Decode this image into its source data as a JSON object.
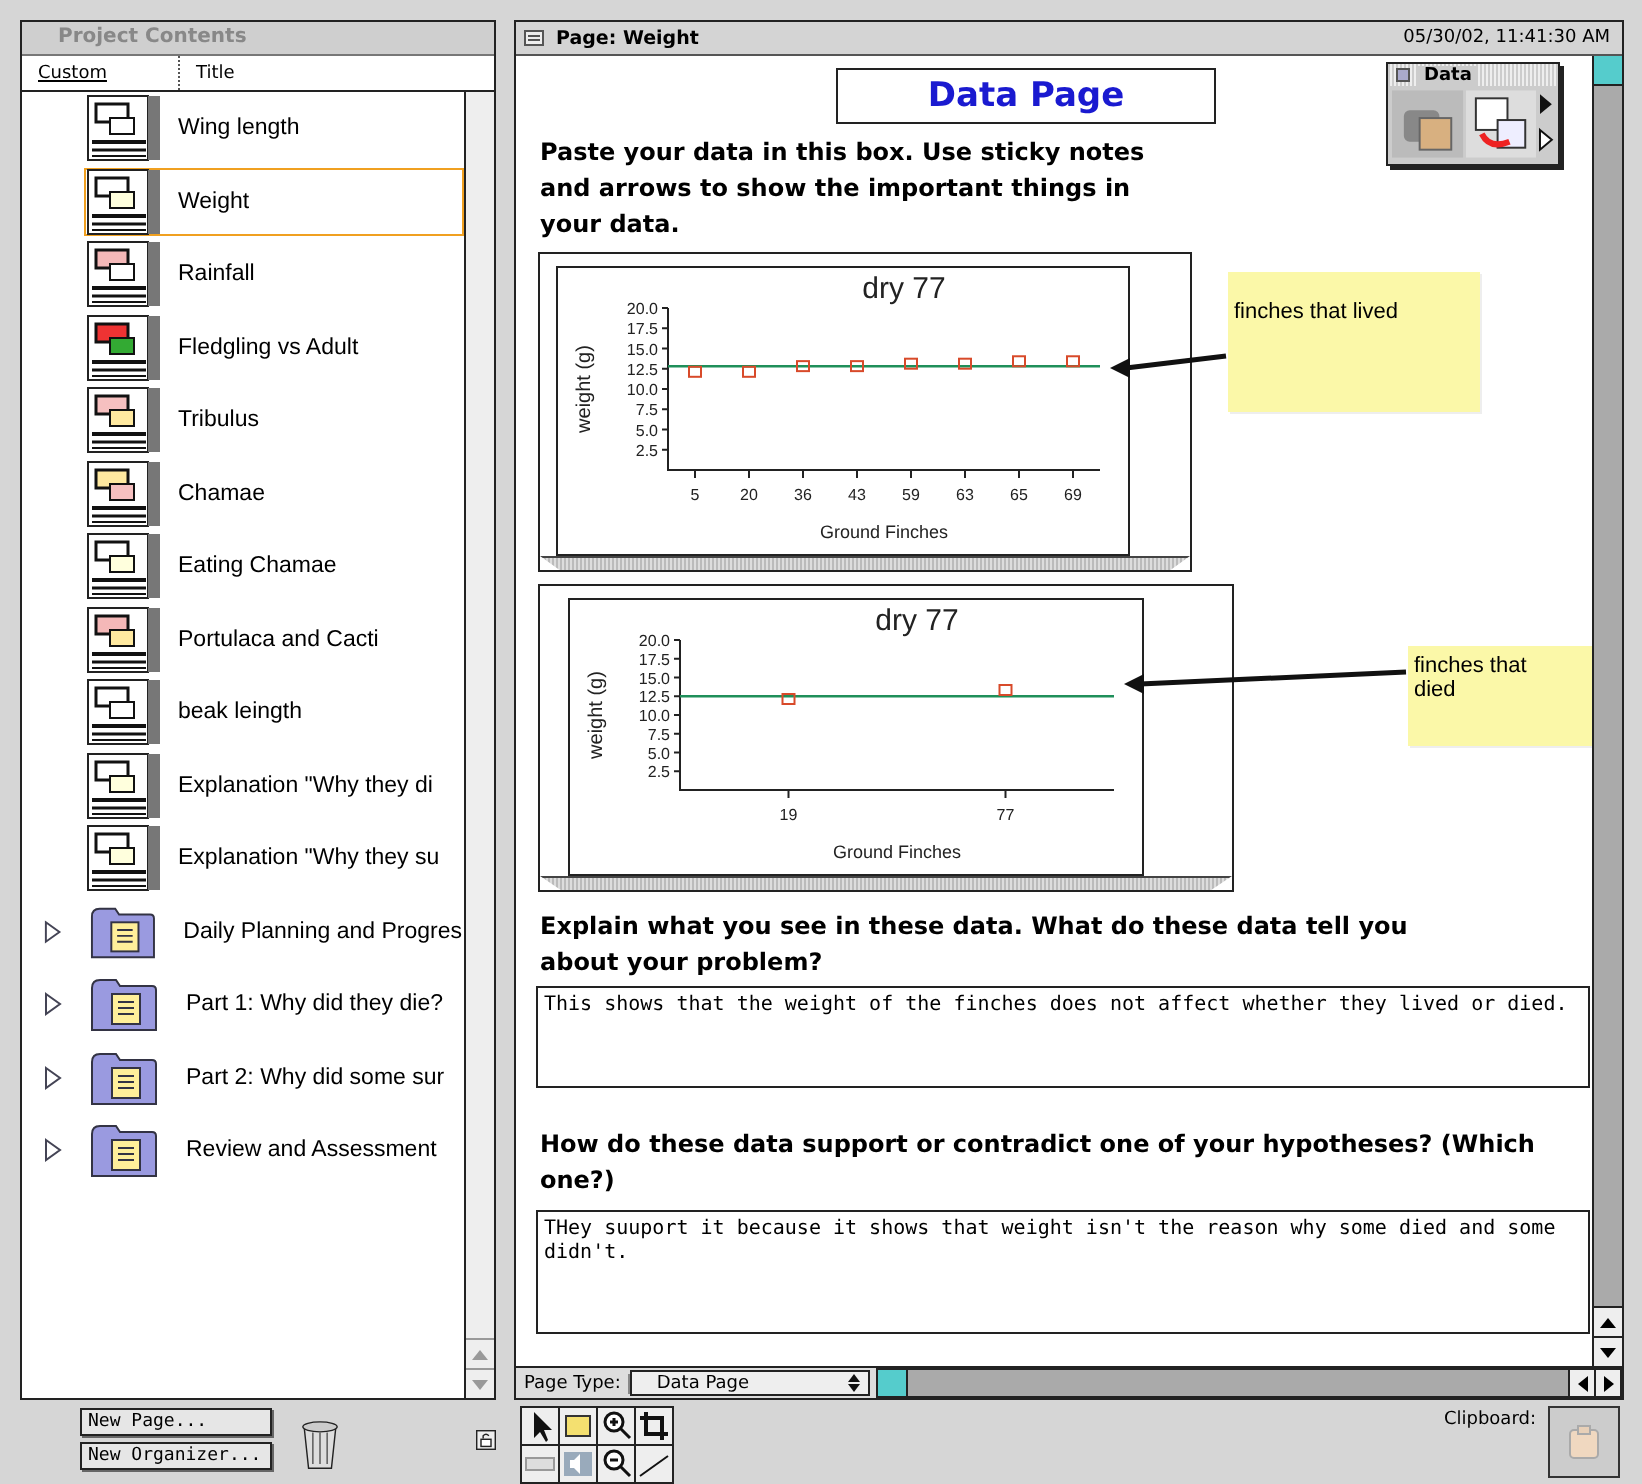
{
  "project_panel": {
    "title": "Project Contents",
    "columns": [
      {
        "label": "Custom",
        "selected": true
      },
      {
        "label": "Title",
        "selected": false
      }
    ],
    "items": [
      {
        "kind": "page",
        "label": "Wing length",
        "selected": false
      },
      {
        "kind": "page",
        "label": "Weight",
        "selected": true
      },
      {
        "kind": "page",
        "label": "Rainfall",
        "selected": false
      },
      {
        "kind": "page",
        "label": "Fledgling vs Adult",
        "selected": false
      },
      {
        "kind": "page",
        "label": "Tribulus",
        "selected": false
      },
      {
        "kind": "page",
        "label": "Chamae",
        "selected": false
      },
      {
        "kind": "page",
        "label": "Eating Chamae",
        "selected": false
      },
      {
        "kind": "page",
        "label": "Portulaca and Cacti",
        "selected": false
      },
      {
        "kind": "page",
        "label": "beak leingth",
        "selected": false
      },
      {
        "kind": "page",
        "label": "Explanation \"Why they di",
        "selected": false
      },
      {
        "kind": "page",
        "label": "Explanation \"Why they su",
        "selected": false
      },
      {
        "kind": "folder",
        "label": "Daily Planning and Progres",
        "expanded": false,
        "selected": false
      },
      {
        "kind": "folder",
        "label": "Part 1: Why did they die?",
        "expanded": false,
        "selected": false
      },
      {
        "kind": "folder",
        "label": "Part 2: Why did some sur",
        "expanded": false,
        "selected": false
      },
      {
        "kind": "folder",
        "label": "Review and Assessment",
        "expanded": false,
        "selected": false
      }
    ],
    "buttons": [
      "New Page...",
      "New Organizer..."
    ]
  },
  "page_window": {
    "title": "Page: Weight",
    "timestamp": "05/30/02, 11:41:30 AM",
    "heading": "Data Page",
    "palette": {
      "title": "Data"
    },
    "instructions": "Paste your data in this box. Use sticky notes and arrows to show the important things in your data.",
    "charts": [
      {
        "note": "finches that lived",
        "chart_data": {
          "type": "scatter",
          "title": "dry 77",
          "xlabel": "Ground Finches",
          "ylabel": "weight (g)",
          "categories": [
            "5",
            "20",
            "36",
            "43",
            "59",
            "63",
            "65",
            "69"
          ],
          "series": [
            {
              "color": "#d84a2a",
              "values": [
                12.0,
                12.0,
                12.7,
                12.7,
                13.0,
                13.0,
                13.3,
                13.3
              ]
            }
          ],
          "ylim": [
            0,
            20
          ],
          "yticks": [
            {
              "value": 2.5,
              "label": "2.5"
            },
            {
              "value": 5,
              "label": "5.0"
            },
            {
              "value": 7.5,
              "label": "7.5"
            },
            {
              "value": 10,
              "label": "10.0"
            },
            {
              "value": 12.5,
              "label": "12.5"
            },
            {
              "value": 15,
              "label": "15.0"
            },
            {
              "value": 17.5,
              "label": "17.5"
            },
            {
              "value": 20,
              "label": "20.0"
            }
          ],
          "ref_lines": [
            {
              "axis": "y",
              "value": 12.8,
              "color": "#1f8f5a"
            }
          ]
        }
      },
      {
        "note": "finches that died",
        "chart_data": {
          "type": "scatter",
          "title": "dry 77",
          "xlabel": "Ground Finches",
          "ylabel": "weight (g)",
          "categories": [
            "19",
            "77"
          ],
          "series": [
            {
              "color": "#d84a2a",
              "values": [
                12.0,
                13.2
              ]
            }
          ],
          "ylim": [
            0,
            20
          ],
          "yticks": [
            {
              "value": 2.5,
              "label": "2.5"
            },
            {
              "value": 5,
              "label": "5.0"
            },
            {
              "value": 7.5,
              "label": "7.5"
            },
            {
              "value": 10,
              "label": "10.0"
            },
            {
              "value": 12.5,
              "label": "12.5"
            },
            {
              "value": 15,
              "label": "15.0"
            },
            {
              "value": 17.5,
              "label": "17.5"
            },
            {
              "value": 20,
              "label": "20.0"
            }
          ],
          "ref_lines": [
            {
              "axis": "y",
              "value": 12.5,
              "color": "#1f8f5a"
            }
          ]
        }
      }
    ],
    "questions": [
      {
        "prompt": "Explain what you see in these data.  What do these data tell you about your problem?",
        "answer": "This shows that the weight of the finches does not affect whether they lived or died."
      },
      {
        "prompt": "How do these data support or contradict one of your hypotheses? (Which one?)",
        "answer": "THey suuport it because it shows that weight isn't the reason why some died and some didn't."
      }
    ],
    "page_type": {
      "label": "Page Type:",
      "value": "Data Page"
    }
  },
  "clipboard": {
    "label": "Clipboard:"
  }
}
